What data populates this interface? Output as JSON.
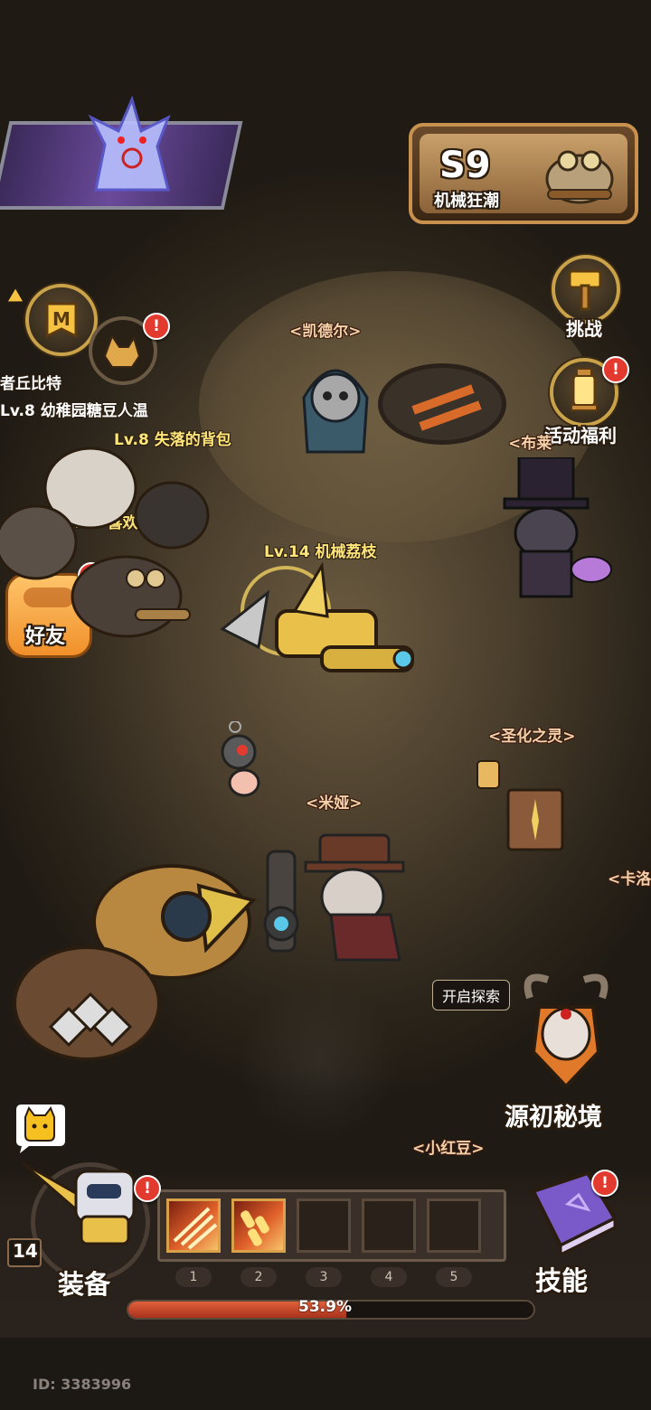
{
  "top_left_emblem": {
    "icon": "spectral-wolf-crest"
  },
  "season_banner": {
    "season": "S9",
    "title": "机械狂潮"
  },
  "right_buttons": {
    "challenge": {
      "label": "挑战",
      "icon": "hammer-icon"
    },
    "event_benefits": {
      "label": "活动福利",
      "icon": "lantern-icon"
    }
  },
  "left_menu": {
    "guild_icon": "m-banner-icon",
    "pet_icon": "dog-silhouette-icon",
    "friends_label": "好友"
  },
  "truncated_names": {
    "left_top": "者丘比特",
    "right_mid": "<布莱",
    "right_low": "<卡洛"
  },
  "players": [
    {
      "label": "Lv.8 幼稚园糖豆人温"
    },
    {
      "label": "Lv.8 失落的背包"
    },
    {
      "label": "Lv.15 喜欢火鸡"
    },
    {
      "label": "Lv.14 机械荔枝"
    }
  ],
  "npcs": {
    "kaideer": "<凯德尔>",
    "shenghua": "<圣化之灵>",
    "miya": "<米娅>",
    "xiaohongdou": "<小红豆>"
  },
  "explore": {
    "tooltip": "开启探索",
    "label": "源初秘境",
    "icon": "ram-skull-icon"
  },
  "bottom_bar": {
    "equip_label": "装备",
    "equip_level": "14",
    "skills_label": "技能",
    "skill_slots": [
      {
        "num": "1",
        "filled": true,
        "icon": "claw-slash-icon"
      },
      {
        "num": "2",
        "filled": true,
        "icon": "bullet-barrage-icon"
      },
      {
        "num": "3",
        "filled": false
      },
      {
        "num": "4",
        "filled": false
      },
      {
        "num": "5",
        "filled": false
      }
    ],
    "progress_text": "53.9%",
    "progress_value": 0.539
  },
  "chat_icon": "cat-face-chat-icon",
  "user_id": "ID: 3383996",
  "colors": {
    "accent_gold": "#d9a24a",
    "badge_red": "#e23a2e",
    "friend_orange": "#f0a040"
  }
}
